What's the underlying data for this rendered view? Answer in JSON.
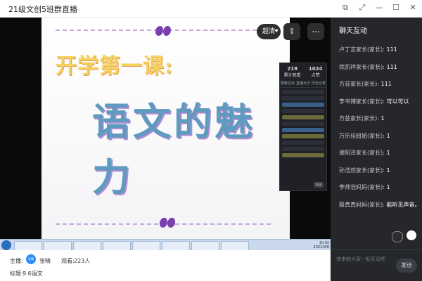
{
  "window": {
    "title": "21级文创5班群直播"
  },
  "video": {
    "quality_label": "超清",
    "slide": {
      "line1": "开学第一课:",
      "line2": "语文的魅力"
    },
    "panel": {
      "stats": [
        {
          "value": "219",
          "label": "累计观看"
        },
        {
          "value": "1024",
          "label": "点赞"
        }
      ],
      "tabs": [
        "群聊互动",
        "直播大厅",
        "历史记录"
      ],
      "send_label": "发送"
    },
    "taskbar": {
      "clock_time": "10:02",
      "clock_date": "2021/9/6"
    }
  },
  "sidebar": {
    "title": "聊天互动",
    "messages": [
      {
        "user": "卢丁言家长(家长):",
        "text": "111"
      },
      {
        "user": "徐凯祥家长(家长):",
        "text": "111"
      },
      {
        "user": "方芸家长(家长):",
        "text": "111"
      },
      {
        "user": "李书博家长(家长):",
        "text": "可以可以"
      },
      {
        "user": "方芸家长(家长):",
        "text": "1"
      },
      {
        "user": "万乐佳妞妞(家长):",
        "text": "1"
      },
      {
        "user": "谢阳泽家长(家长):",
        "text": "1"
      },
      {
        "user": "孙浩然家长(家长):",
        "text": "1"
      },
      {
        "user": "李帅浩妈妈(家长):",
        "text": "1"
      },
      {
        "user": "殷真真妈妈(家长):",
        "text": "能听见声音。"
      }
    ],
    "input_placeholder": "快来和大家一起互动吧",
    "send_label": "发送"
  },
  "footer": {
    "host_label": "主播:",
    "host_avatar_text": "张晴",
    "host_name": "张晴",
    "views_label": "观看:",
    "views_value": "223人",
    "title_label": "标题:",
    "title_value": "9.6语文"
  }
}
